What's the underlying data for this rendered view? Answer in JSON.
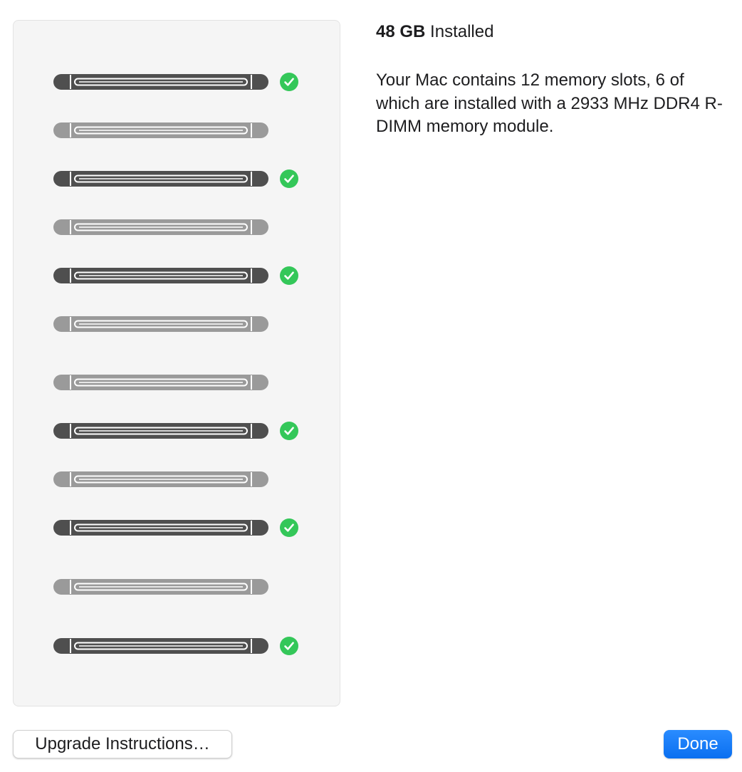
{
  "summary": {
    "amount": "48 GB",
    "installed_label": "Installed"
  },
  "description": "Your Mac contains 12 memory slots, 6 of which are installed with a 2933 MHz DDR4 R-DIMM memory module.",
  "memory_slots": [
    {
      "slot": 1,
      "installed": true
    },
    {
      "slot": 2,
      "installed": false
    },
    {
      "slot": 3,
      "installed": true
    },
    {
      "slot": 4,
      "installed": false
    },
    {
      "slot": 5,
      "installed": true
    },
    {
      "slot": 6,
      "installed": false
    },
    {
      "slot": 7,
      "installed": false
    },
    {
      "slot": 8,
      "installed": true
    },
    {
      "slot": 9,
      "installed": false
    },
    {
      "slot": 10,
      "installed": true
    },
    {
      "slot": 11,
      "installed": false
    },
    {
      "slot": 12,
      "installed": true
    }
  ],
  "icons": {
    "installed": "checkmark-circle-icon",
    "module": "memory-module-icon"
  },
  "buttons": {
    "upgrade_label": "Upgrade Instructions…",
    "done_label": "Done"
  },
  "colors": {
    "installed_module": "#4f4f4f",
    "empty_module": "#9a9a9a",
    "check": "#34c759",
    "accent": "#0a72f0",
    "panel_bg": "#f5f5f5"
  }
}
